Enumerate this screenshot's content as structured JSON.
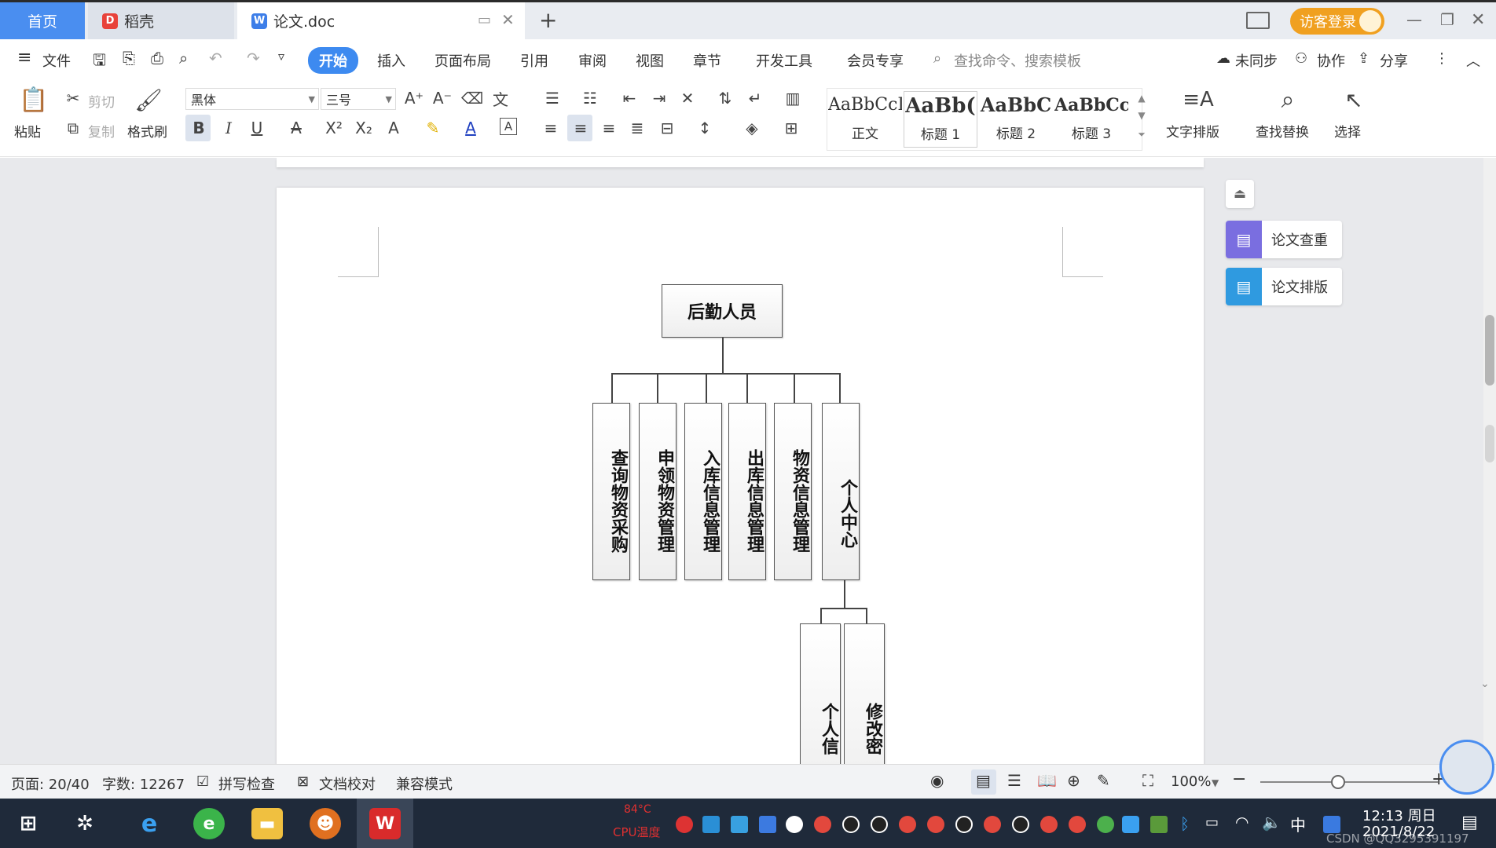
{
  "tabs": {
    "home": "首页",
    "daoke": "稻壳",
    "doc": "论文.doc",
    "new_tab": "+",
    "login": "访客登录"
  },
  "menu": {
    "file": "文件",
    "items": [
      "开始",
      "插入",
      "页面布局",
      "引用",
      "审阅",
      "视图",
      "章节",
      "开发工具",
      "会员专享"
    ],
    "search_placeholder": "查找命令、搜索模板",
    "unsync": "未同步",
    "collab": "协作",
    "share": "分享"
  },
  "ribbon": {
    "paste": "粘贴",
    "cut": "剪切",
    "copy": "复制",
    "format_painter": "格式刷",
    "font": "黑体",
    "font_size": "三号",
    "styles": [
      {
        "sample": "AaBbCcI",
        "label": "正文"
      },
      {
        "sample": "AaBb(",
        "label": "标题 1"
      },
      {
        "sample": "AaBbC",
        "label": "标题 2"
      },
      {
        "sample": "AaBbCcI",
        "label": "标题 3"
      }
    ],
    "text_layout": "文字排版",
    "find_replace": "查找替换",
    "select": "选择"
  },
  "side_panel": {
    "check": "论文查重",
    "layout": "论文排版"
  },
  "diagram": {
    "root": "后勤人员",
    "children": [
      "查询物资采购",
      "申领物资管理",
      "入库信息管理",
      "出库信息管理",
      "物资信息管理",
      "个人中心"
    ],
    "grandchildren": [
      "个人信",
      "修改密"
    ]
  },
  "status": {
    "page": "页面: 20/40",
    "words": "字数: 12267",
    "spell": "拼写检查",
    "proof": "文档校对",
    "compat": "兼容模式",
    "zoom": "100%"
  },
  "taskbar": {
    "temp": "84°C",
    "cpu": "CPU温度",
    "time": "12:13 周日",
    "date": "2021/8/22",
    "ime": "中",
    "watermark": "CSDN @QQ3295391197"
  },
  "colors": {
    "accent": "#3d8af0",
    "login_bg": "#f0a020",
    "taskbar": "#1f2a3a"
  }
}
